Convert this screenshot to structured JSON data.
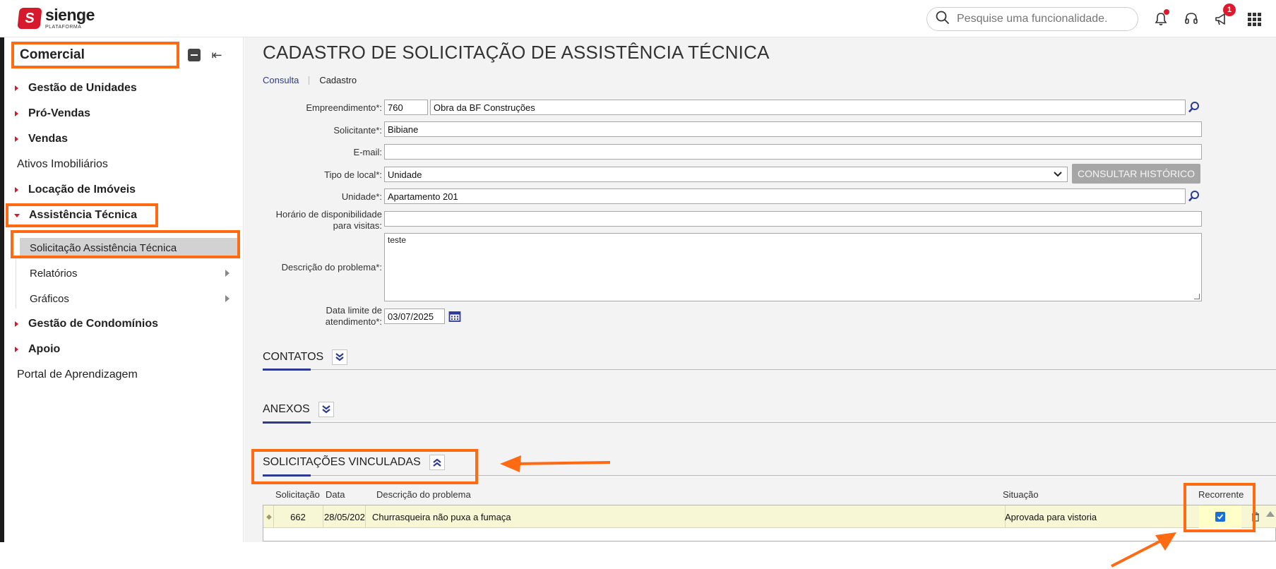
{
  "header": {
    "brand_name": "sienge",
    "brand_sub": "PLATAFORMA",
    "logo_letter": "S",
    "search_placeholder": "Pesquise uma funcionalidade.",
    "megaphone_badge": "1"
  },
  "sidebar": {
    "module_title": "Comercial",
    "items": [
      {
        "label": "Gestão de Unidades"
      },
      {
        "label": "Pró-Vendas"
      },
      {
        "label": "Vendas"
      },
      {
        "label": "Ativos Imobiliários"
      },
      {
        "label": "Locação de Imóveis"
      },
      {
        "label": "Assistência Técnica"
      },
      {
        "label": "Solicitação Assistência Técnica"
      },
      {
        "label": "Relatórios"
      },
      {
        "label": "Gráficos"
      },
      {
        "label": "Gestão de Condomínios"
      },
      {
        "label": "Apoio"
      },
      {
        "label": "Portal de Aprendizagem"
      }
    ]
  },
  "main": {
    "title": "CADASTRO DE SOLICITAÇÃO DE ASSISTÊNCIA TÉCNICA",
    "breadcrumb": {
      "consulta": "Consulta",
      "cadastro": "Cadastro"
    },
    "form": {
      "empreendimento_label": "Empreendimento*:",
      "empreendimento_code": "760",
      "empreendimento_name": "Obra da BF Construções",
      "solicitante_label": "Solicitante*:",
      "solicitante_value": "Bibiane",
      "email_label": "E-mail:",
      "email_value": "",
      "tipo_local_label": "Tipo de local*:",
      "tipo_local_value": "Unidade",
      "consultar_historico": "CONSULTAR HISTÓRICO",
      "unidade_label": "Unidade*:",
      "unidade_value": "Apartamento 201",
      "horario_label_1": "Horário de disponibilidade",
      "horario_label_2": "para visitas:",
      "horario_value": "",
      "descricao_label": "Descrição do problema*:",
      "descricao_value": "teste",
      "data_limite_label_1": "Data limite de",
      "data_limite_label_2": "atendimento*:",
      "data_limite_value": "03/07/2025"
    },
    "sections": {
      "contatos": "CONTATOS",
      "anexos": "ANEXOS",
      "vinculadas": "SOLICITAÇÕES VINCULADAS"
    },
    "table": {
      "columns": [
        "Solicitação",
        "Data",
        "Descrição do problema",
        "Situação",
        "Recorrente"
      ],
      "rows": [
        {
          "solicitacao": "662",
          "data": "28/05/202",
          "descricao": "Churrasqueira não puxa a fumaça",
          "situacao": "Aprovada para vistoria",
          "recorrente": true
        }
      ]
    }
  },
  "colors": {
    "accent_orange": "#ff6a13",
    "brand_red": "#d7192d",
    "link_blue": "#2c3b8f",
    "row_highlight": "#f7f7d6"
  }
}
